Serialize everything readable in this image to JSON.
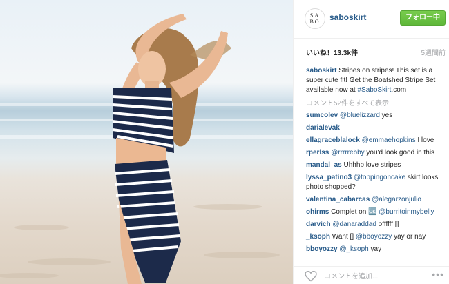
{
  "profile": {
    "avatar_text": "SA BO",
    "username": "saboskirt",
    "follow_label": "フォロー中"
  },
  "post": {
    "likes": "いいね！13.3k件",
    "age": "5週間前",
    "caption_user": "saboskirt",
    "caption_text": " Stripes on stripes! This set is a super cute fit! Get the Boatshed Stripe Set available now at ",
    "caption_tag": "#SaboSkirt",
    "caption_end": ".com",
    "view_all": "コメント52件をすべて表示"
  },
  "comments": [
    {
      "user": "sumcolev",
      "mention": "@bluelizzard",
      "text": " yes"
    },
    {
      "user": "darialevak",
      "mention": "",
      "text": ""
    },
    {
      "user": "ellagraceblalock",
      "mention": "@emmaehopkins",
      "text": " I love"
    },
    {
      "user": "rperlss",
      "mention": "@rrrrrebby",
      "text": " you'd look good in this"
    },
    {
      "user": "mandal_as",
      "mention": "",
      "text": " Uhhhb love stripes"
    },
    {
      "user": "lyssa_patino3",
      "mention": "@toppingoncake",
      "text": " skirt looks photo shopped?"
    },
    {
      "user": "valentina_cabarcas",
      "mention": "@alegarzonjulio",
      "text": ""
    },
    {
      "user": "ohirms",
      "mention": "",
      "text": " Complet on 🆗 ",
      "mention2": "@burritoinmybelly"
    },
    {
      "user": "darvich",
      "mention": "@danaraddad",
      "text": " offffff []"
    },
    {
      "user": "_ksoph",
      "mention": "",
      "text": " Want [] ",
      "mention2": "@bboyozzy",
      "text2": " yay or nay"
    },
    {
      "user": "bboyozzy",
      "mention": "@_ksoph",
      "text": " yay"
    }
  ],
  "footer": {
    "comment_placeholder": "コメントを追加...",
    "more_glyph": "•••"
  },
  "icons": {
    "heart": "heart-icon",
    "more": "more-options-icon"
  },
  "colors": {
    "link": "#275a89",
    "follow": "#6cc644",
    "muted": "#a5a7aa"
  }
}
